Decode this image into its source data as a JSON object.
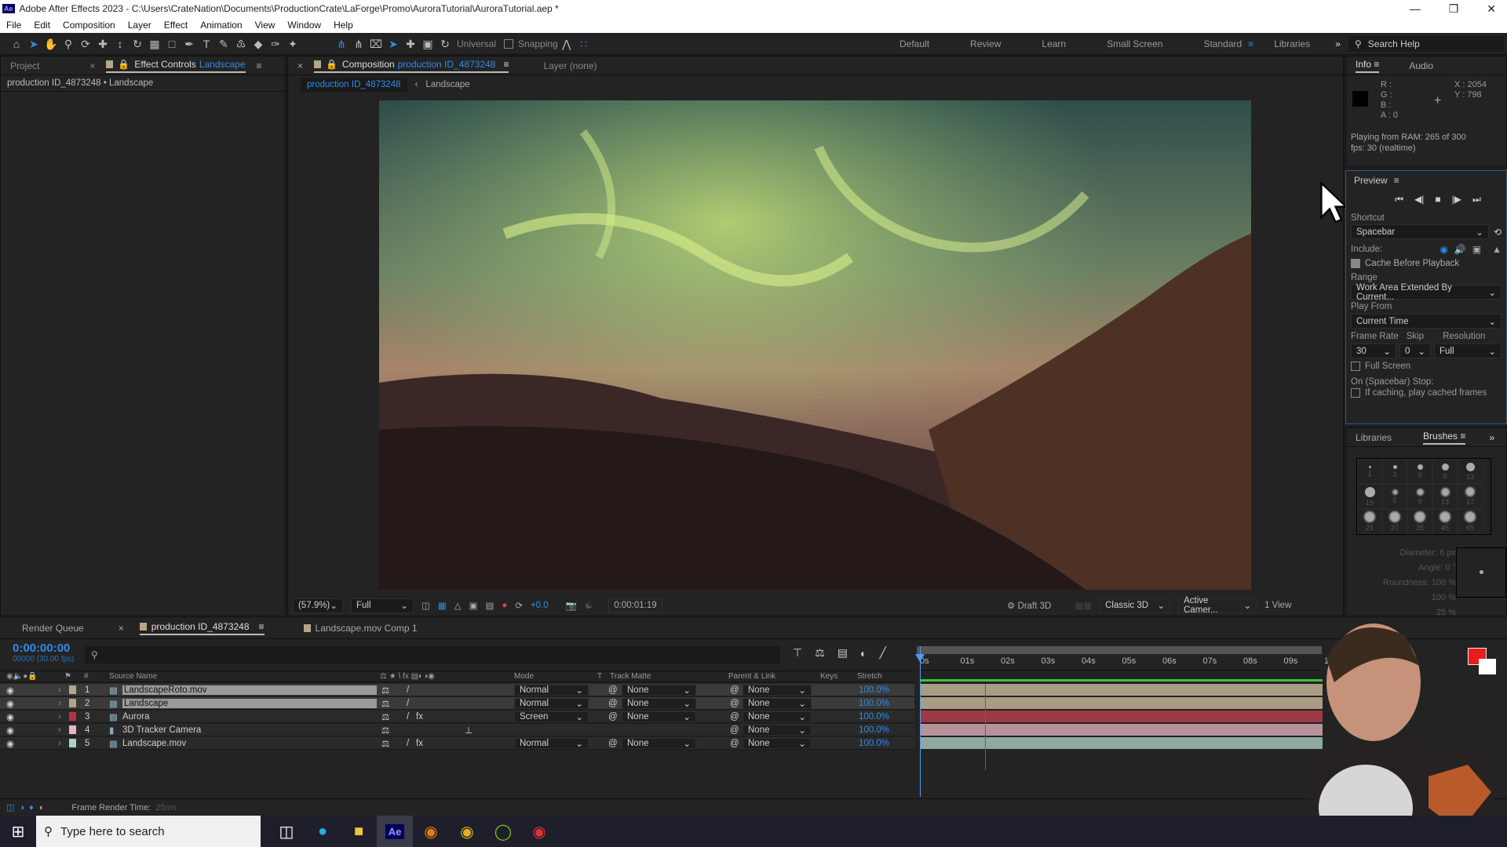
{
  "window": {
    "title": "Adobe After Effects 2023 - C:\\Users\\CrateNation\\Documents\\ProductionCrate\\LaForge\\Promo\\AuroraTutorial\\AuroraTutorial.aep *",
    "app_icon": "Ae"
  },
  "menu": [
    "File",
    "Edit",
    "Composition",
    "Layer",
    "Effect",
    "Animation",
    "View",
    "Window",
    "Help"
  ],
  "toolbar": {
    "universal": "Universal",
    "snapping": "Snapping",
    "workspaces": [
      "Default",
      "Review",
      "Learn",
      "Small Screen",
      "Standard",
      "Libraries"
    ],
    "active_workspace": "Standard",
    "search_placeholder": "Search Help"
  },
  "left_panel": {
    "tabs": {
      "project": "Project",
      "effect_controls": "Effect Controls",
      "effect_target": "Landscape"
    },
    "subheader": "production ID_4873248 • Landscape"
  },
  "comp_panel": {
    "tab_prefix": "Composition",
    "comp_name": "production ID_4873248",
    "layer_tab": "Layer (none)",
    "breadcrumb": [
      "production ID_4873248",
      "Landscape"
    ],
    "footer": {
      "zoom": "(57.9%)",
      "resolution": "Full",
      "exposure": "+0.0",
      "timecode": "0:00:01:19",
      "renderer": "Draft 3D",
      "classic": "Classic 3D",
      "camera": "Active Camer...",
      "views": "1 View"
    }
  },
  "info": {
    "tabs": [
      "Info",
      "Audio"
    ],
    "r": "R :",
    "g": "G :",
    "b": "B :",
    "a": "A : 0",
    "x": "X : 2054",
    "y": "Y : 798",
    "status1": "Playing from RAM: 265 of 300",
    "status2": "fps: 30 (realtime)"
  },
  "preview": {
    "title": "Preview",
    "shortcut_label": "Shortcut",
    "shortcut": "Spacebar",
    "include_label": "Include:",
    "cache_label": "Cache Before Playback",
    "cache_checked": true,
    "range_label": "Range",
    "range": "Work Area Extended By Current...",
    "play_from_label": "Play From",
    "play_from": "Current Time",
    "frame_rate_label": "Frame Rate",
    "frame_rate": "30",
    "skip_label": "Skip",
    "skip": "0",
    "resolution_label": "Resolution",
    "resolution": "Full",
    "full_screen_label": "Full Screen",
    "full_screen_checked": false,
    "on_stop_label": "On (Spacebar) Stop:",
    "caching_label": "If caching, play cached frames"
  },
  "brushes": {
    "tabs": [
      "Libraries",
      "Brushes"
    ],
    "sizes": [
      "1",
      "3",
      "5",
      "9",
      "13",
      "19",
      "5",
      "9",
      "13",
      "17",
      "21",
      "27",
      "35",
      "45",
      "65"
    ],
    "diameter": "Diameter: 6 px",
    "angle": "Angle: 0 °",
    "roundness": "Roundness: 100 %",
    "hardness": "100 %",
    "spacing": "25 %"
  },
  "timeline": {
    "tabs": [
      "Render Queue",
      "production ID_4873248",
      "Landscape.mov Comp 1"
    ],
    "timecode": "0:00:00:00",
    "frames": "00000 (30.00 fps)",
    "columns": {
      "num": "#",
      "source": "Source Name",
      "mode": "Mode",
      "t": "T",
      "track_matte": "Track Matte",
      "parent": "Parent & Link",
      "keys": "Keys",
      "stretch": "Stretch"
    },
    "ruler": [
      "0s",
      "01s",
      "02s",
      "03s",
      "04s",
      "05s",
      "06s",
      "07s",
      "08s",
      "09s",
      "1"
    ],
    "layers": [
      {
        "num": "1",
        "name": "LandscapeRoto.mov",
        "label_color": "#b5a58a",
        "bar_color": "#a89c84",
        "mode": "Normal",
        "matte": "None",
        "parent": "None",
        "stretch": "100.0%",
        "fx": false
      },
      {
        "num": "2",
        "name": "Landscape",
        "label_color": "#b5a58a",
        "bar_color": "#a89c84",
        "mode": "Normal",
        "matte": "None",
        "parent": "None",
        "stretch": "100.0%",
        "fx": false
      },
      {
        "num": "3",
        "name": "Aurora",
        "label_color": "#b8323c",
        "bar_color": "#9c3a44",
        "mode": "Screen",
        "matte": "None",
        "parent": "None",
        "stretch": "100.0%",
        "fx": true
      },
      {
        "num": "4",
        "name": "3D Tracker Camera",
        "label_color": "#e6b5c2",
        "bar_color": "#b8929a",
        "mode": "",
        "matte": "",
        "parent": "None",
        "stretch": "100.0%",
        "fx": false
      },
      {
        "num": "5",
        "name": "Landscape.mov",
        "label_color": "#a9d2c4",
        "bar_color": "#8fa8a0",
        "mode": "Normal",
        "matte": "None",
        "parent": "None",
        "stretch": "100.0%",
        "fx": true
      }
    ],
    "status": "Frame Render Time:",
    "render_time": "25ms"
  },
  "taskbar": {
    "search_placeholder": "Type here to search",
    "apps": [
      "task-view",
      "edge",
      "file-explorer",
      "after-effects",
      "blender",
      "chrome",
      "green-app",
      "chrome-profile"
    ]
  },
  "colors": {
    "accent": "#2d8ceb",
    "playhead": "#4a9ff5",
    "cache_bar": "#3cc43c",
    "fg_color": "#e81c1c"
  }
}
